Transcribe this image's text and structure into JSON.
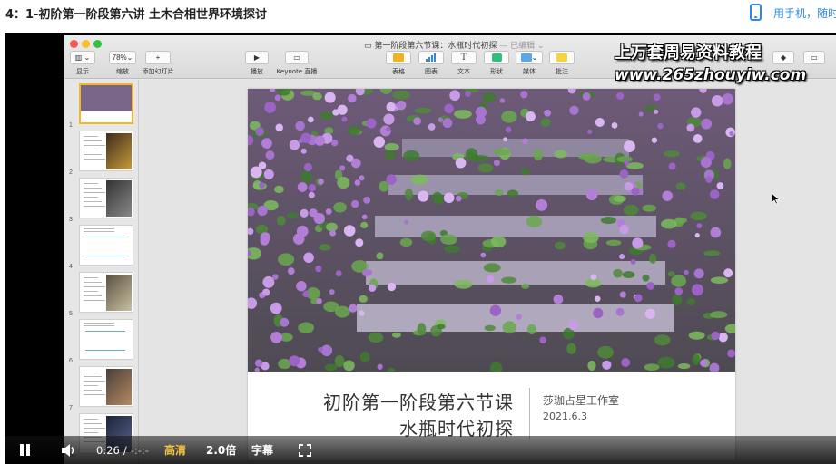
{
  "page": {
    "title": "4：1-初阶第一阶段第六讲 土木合相世界环境探讨",
    "mobile_link": "用手机，随时"
  },
  "keynote": {
    "doc_title": "第一阶段第六节课：水瓶时代初探",
    "doc_status": "— 已编辑",
    "toolbar": {
      "view_label": "显示",
      "zoom_value": "78%",
      "zoom_label": "缩放",
      "add_slide_label": "添加幻灯片",
      "play_label": "播放",
      "live_label": "Keynote 直播",
      "table_label": "表格",
      "chart_label": "图表",
      "text_label": "文本",
      "shape_label": "形状",
      "media_label": "媒体",
      "comment_label": "批注"
    },
    "slides": [
      {
        "num": "1"
      },
      {
        "num": "2"
      },
      {
        "num": "3"
      },
      {
        "num": "4"
      },
      {
        "num": "5"
      },
      {
        "num": "6"
      },
      {
        "num": "7"
      },
      {
        "num": "8"
      }
    ],
    "current_slide": {
      "heading_line1": "初阶第一阶段第六节课",
      "heading_line2": "水瓶时代初探",
      "studio": "莎珈占星工作室",
      "date": "2021.6.3"
    }
  },
  "watermark": {
    "line1": "上万套周易资料教程",
    "line2": "www.265zhouyiw.com"
  },
  "player": {
    "current_time": "0:26",
    "separator": "/",
    "duration": "-:-:-",
    "quality_label": "高清",
    "speed_label": "2.0倍",
    "subtitle_label": "字幕",
    "state": "playing",
    "quality_color": "#f4c542"
  }
}
